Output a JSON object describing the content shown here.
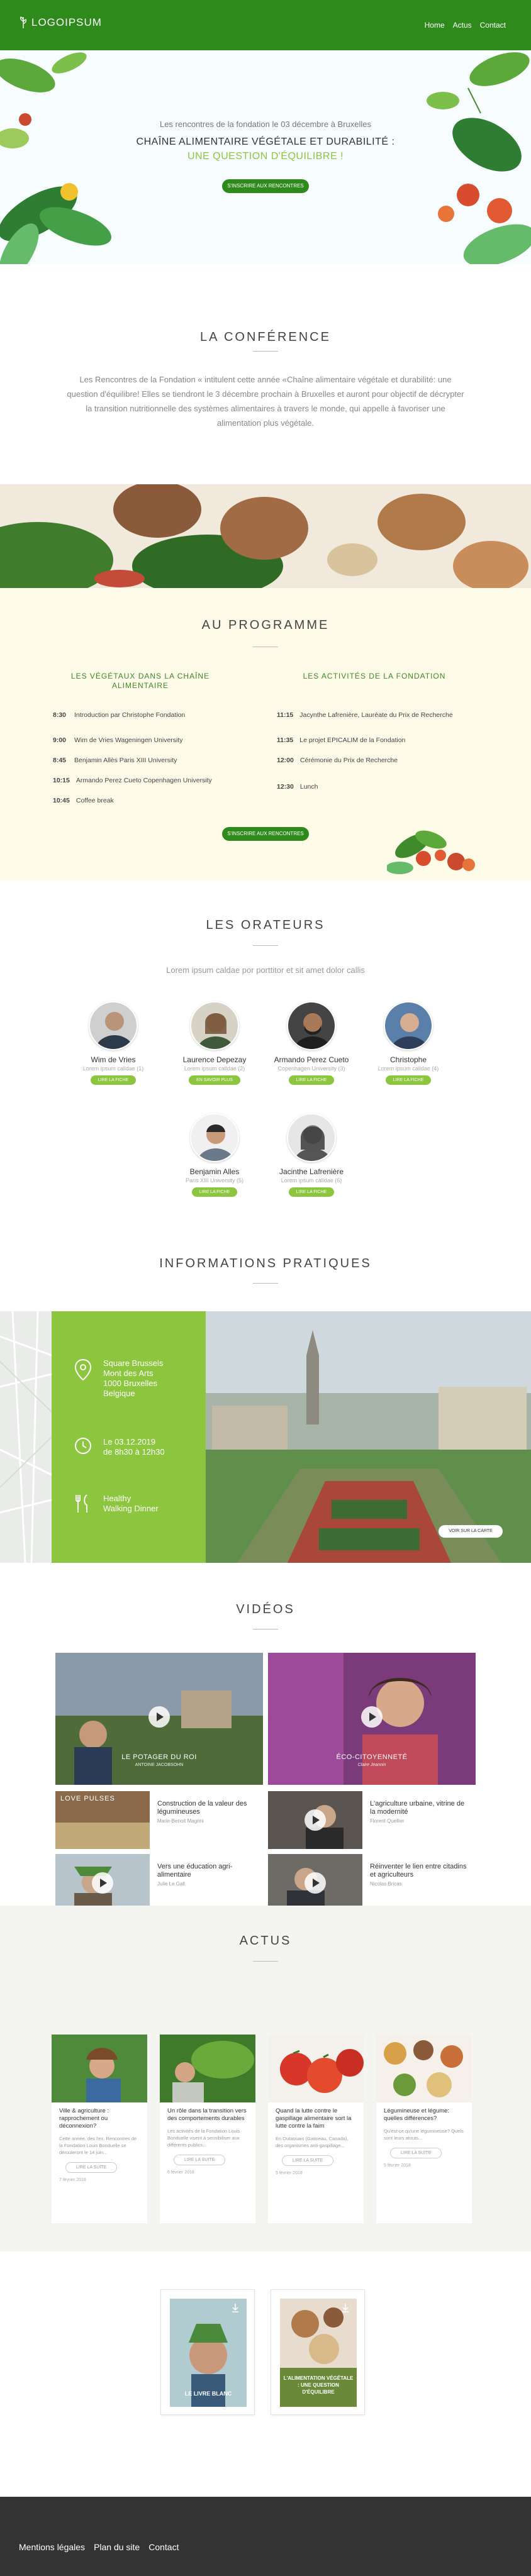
{
  "header": {
    "logo": "LOGOIPSUM",
    "nav": [
      "Home",
      "Actus",
      "Contact"
    ]
  },
  "hero": {
    "tagline": "Les rencontres de la fondation le 03 décembre à Bruxelles",
    "title": "CHAÎNE ALIMENTAIRE VÉGÉTALE ET DURABILITÉ :",
    "subtitle": "UNE QUESTION D'ÉQUILIBRE !",
    "button": "S'INSCRIRE AUX RENCONTRES"
  },
  "conference": {
    "title": "LA CONFÉRENCE",
    "text": "Les Rencontres de la Fondation « intitulent cette année «Chaîne alimentaire végétale et durabilité: une question d'équilibre! Elles se tiendront le 3 décembre prochain à Bruxelles et auront pour objectif de décrypter la transition nutritionnelle des systèmes alimentaires à travers le monde, qui appelle à favoriser une alimentation plus végétale."
  },
  "programme": {
    "title": "AU PROGRAMME",
    "left_title": "LES VÉGÉTAUX DANS LA CHAÎNE ALIMENTAIRE",
    "right_title": "LES ACTIVITÉS DE LA FONDATION",
    "left": [
      {
        "time": "8:30",
        "text": "Introduction par Christophe Fondation"
      },
      {
        "time": "9:00",
        "text": "Wim de Vries Wageningen University"
      },
      {
        "time": "8:45",
        "text": "Benjamin Allès Paris XIII University"
      },
      {
        "time": "10:15",
        "text": "Armando Perez Cueto Copenhagen University"
      },
      {
        "time": "10:45",
        "text": "Coffee break"
      }
    ],
    "right": [
      {
        "time": "11:15",
        "text": "Jacynthe Lafrenière, Lauréate du Prix de Recherche"
      },
      {
        "time": "11:35",
        "text": "Le projet EPICALIM de la Fondation"
      },
      {
        "time": "12:00",
        "text": "Cérémonie du Prix de Recherche"
      },
      {
        "time": "12:30",
        "text": "Lunch"
      }
    ],
    "button": "S'INSCRIRE AUX RENCONTRES"
  },
  "speakers": {
    "title": "LES ORATEURS",
    "intro": "Lorem ipsum caldae por porttitor et sit amet dolor callis",
    "items": [
      {
        "name": "Wim de Vries",
        "affil": "Lorem ipsum calldae (1)",
        "button": "LIRE LA FICHE"
      },
      {
        "name": "Laurence Depezay",
        "affil": "Lorem ipsum calldae (2)",
        "button": "EN SAVOIR PLUS"
      },
      {
        "name": "Armando Perez Cueto",
        "affil": "Copenhagen University (3)",
        "button": "LIRE LA FICHE"
      },
      {
        "name": "Christophe",
        "affil": "Lorem ipsum calldae (4)",
        "button": "LIRE LA FICHE"
      },
      {
        "name": "Benjamin Alles",
        "affil": "Paris XIII University (5)",
        "button": "LIRE LA FICHE"
      },
      {
        "name": "Jacinthe Lafrenière",
        "affil": "Lorem ipsum calldae (6)",
        "button": "LIRE LA FICHE"
      }
    ]
  },
  "infos": {
    "title": "INFORMATIONS PRATIQUES",
    "address": [
      "Square Brussels",
      "Mont des Arts",
      "1000 Bruxelles",
      "Belgique"
    ],
    "date": [
      "Le 03.12.2019",
      "de 8h30 à 12h30"
    ],
    "meal": [
      "Healthy",
      "Walking Dinner"
    ],
    "map_button": "VOIR SUR LA CARTE"
  },
  "videos": {
    "title": "VIDÉOS",
    "main": [
      {
        "title": "LE POTAGER DU ROI",
        "sub": "ANTOINE JACOBSOHN"
      },
      {
        "title": "ÉCO-CITOYENNETÉ",
        "sub": "Claire Jeannin"
      }
    ],
    "small": [
      {
        "thumb": "LOVE PULSES",
        "title": "Construction de la valeur des légumineuses",
        "sub": "Marie-Benoit Magrini"
      },
      {
        "thumb": "",
        "title": "L'agriculture urbaine, vitrine de la modernité",
        "sub": "Florent Quellier"
      },
      {
        "thumb": "",
        "title": "Vers une éducation agri-alimentaire",
        "sub": "Julie Le Gall"
      },
      {
        "thumb": "",
        "title": "Réinventer le lien entre citadins et agriculteurs",
        "sub": "Nicolas Bricas"
      }
    ]
  },
  "actus": {
    "title": "ACTUS",
    "items": [
      {
        "title": "Ville & agriculture : rapprochement ou déconnexion?",
        "excerpt": "Cette année, des l'ex. Rencontres de la Fondation Louis Bonduelle se dérouleront le 14 juin...",
        "button": "LIRE LA SUITE",
        "date": "7 février 2018"
      },
      {
        "title": "Un rôle dans la transition vers des comportements durables",
        "excerpt": "Les activités de la Fondation Louis Bonduelle visent à sensibiliser aux différents publics...",
        "button": "LIRE LA SUITE",
        "date": "6 février 2018"
      },
      {
        "title": "Quand la lutte contre le gaspillage alimentaire sort la lutte contre la faim",
        "excerpt": "En Outaouais (Gatineau, Canada), des organismes anti-gaspillage...",
        "button": "LIRE LA SUITE",
        "date": "5 février 2018"
      },
      {
        "title": "Légumineuse et légume: quelles différences?",
        "excerpt": "Qu'est-ce qu'une légumineuse? Quels sont leurs atouts...",
        "button": "LIRE LA SUITE",
        "date": "5 février 2018"
      }
    ]
  },
  "books": [
    {
      "label": "LE LIVRE BLANC"
    },
    {
      "label": "L'ALIMENTATION VÉGÉTALE : UNE QUESTION D'ÉQUILIBRE"
    }
  ],
  "footer": {
    "links": [
      "Mentions légales",
      "Plan du site",
      "Contact"
    ]
  },
  "colors": {
    "brand": "#2f8a1c",
    "accent": "#8cc63f",
    "cream": "#fffbe9",
    "footer": "#333333"
  }
}
